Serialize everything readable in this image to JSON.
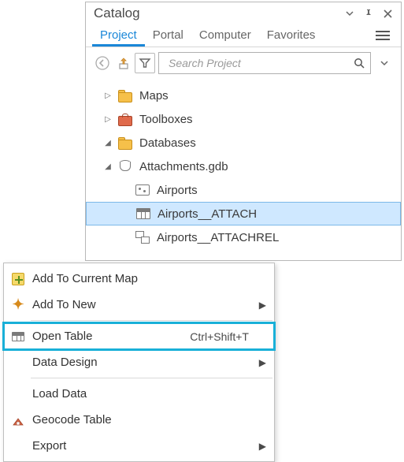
{
  "pane": {
    "title": "Catalog",
    "tabs": [
      "Project",
      "Portal",
      "Computer",
      "Favorites"
    ],
    "active_tab": 0,
    "search_placeholder": "Search Project"
  },
  "tree": {
    "maps": "Maps",
    "toolboxes": "Toolboxes",
    "databases": "Databases",
    "gdb": "Attachments.gdb",
    "fc": "Airports",
    "attach_table": "Airports__ATTACH",
    "attach_rel": "Airports__ATTACHREL"
  },
  "menu": {
    "add_current": "Add To Current Map",
    "add_new": "Add To New",
    "open_table": "Open Table",
    "open_table_shortcut": "Ctrl+Shift+T",
    "data_design": "Data Design",
    "load_data": "Load Data",
    "geocode": "Geocode Table",
    "export": "Export"
  }
}
